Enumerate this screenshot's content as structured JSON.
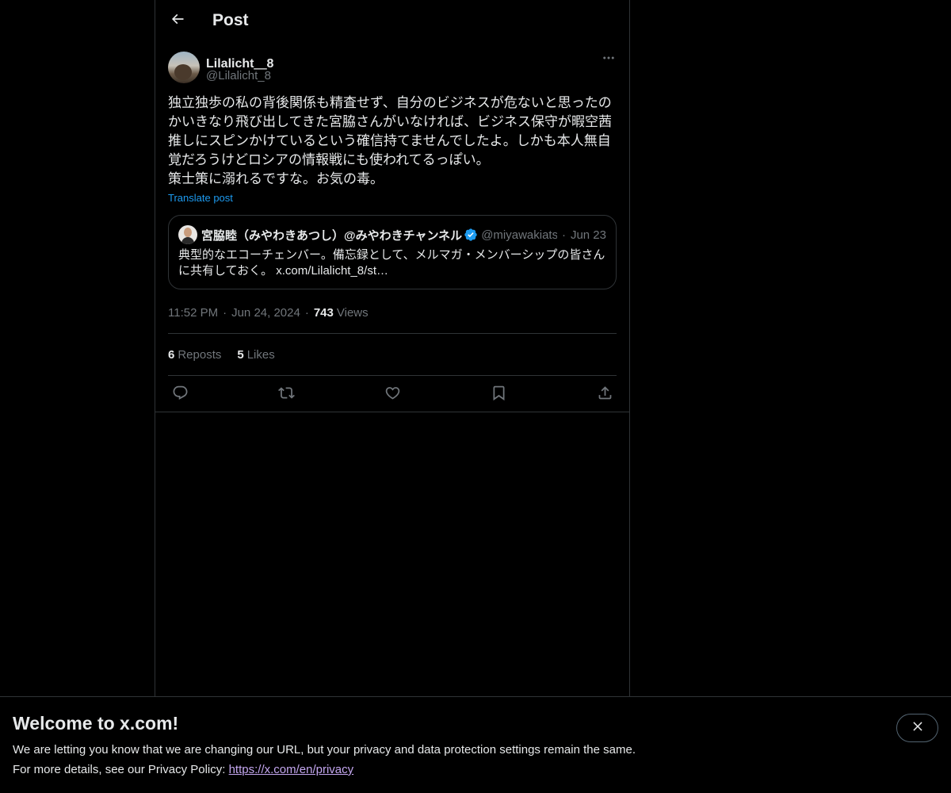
{
  "header": {
    "title": "Post"
  },
  "post": {
    "author_name": "Lilalicht＿8",
    "author_handle": "@Lilalicht_8",
    "text": "独立独歩の私の背後関係も精査せず、自分のビジネスが危ないと思ったの\nかいきなり飛び出してきた宮脇さんがいなければ、ビジネス保守が暇空茜\n推しにスピンかけているという確信持てませんでしたよ。しかも本人無自\n覚だろうけどロシアの情報戦にも使われてるっぽい。\n策士策に溺れるですな。お気の毒。",
    "translate_label": "Translate post",
    "time": "11:52 PM",
    "date": "Jun 24, 2024",
    "views_count": "743",
    "views_label": "Views",
    "reposts_count": "6",
    "reposts_label": "Reposts",
    "likes_count": "5",
    "likes_label": "Likes"
  },
  "quote": {
    "name": "宮脇睦（みやわきあつし）@みやわきチャンネル",
    "handle": "@miyawakiatsushi",
    "date": "Jun 23",
    "text": "典型的なエコーチェンバー。備忘録として、メルマガ・メンバーシップの皆さんに共有しておく。 x.com/Lilalicht_8/st…"
  },
  "banner": {
    "title": "Welcome to x.com!",
    "line1": "We are letting you know that we are changing our URL, but your privacy and data protection settings remain the same.",
    "line2_prefix": "For more details, see our Privacy Policy: ",
    "link": "https://x.com/en/privacy"
  },
  "icons": {
    "back": "arrow-left-icon",
    "more": "more-horizontal-icon",
    "verified": "verified-badge-icon",
    "reply": "reply-icon",
    "repost": "repost-icon",
    "like": "heart-icon",
    "bookmark": "bookmark-icon",
    "share": "share-icon",
    "close": "close-icon"
  },
  "colors": {
    "background": "#000000",
    "text": "#e7e9ea",
    "secondary": "#71767b",
    "accent": "#1d9bf0",
    "border": "#2f3336"
  }
}
